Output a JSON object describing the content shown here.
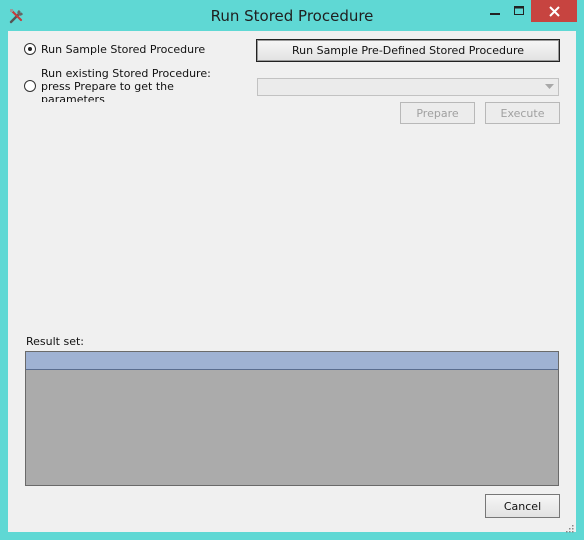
{
  "window": {
    "title": "Run Stored Procedure"
  },
  "options": {
    "sample_label": "Run Sample Stored Procedure",
    "existing_label": "Run existing Stored Procedure: press Prepare to get the parameters"
  },
  "buttons": {
    "predefined": "Run Sample Pre-Defined Stored Procedure",
    "prepare": "Prepare",
    "execute": "Execute",
    "cancel": "Cancel"
  },
  "procedure_select": {
    "value": ""
  },
  "result": {
    "label": "Result set:"
  },
  "colors": {
    "titlebar": "#5fd8d4",
    "close": "#c74440",
    "grid_header": "#9fb2d3",
    "grid_body": "#ababab"
  },
  "icons": {
    "app": "tools-icon",
    "minimize": "minimize-icon",
    "maximize": "maximize-icon",
    "close": "close-icon"
  }
}
